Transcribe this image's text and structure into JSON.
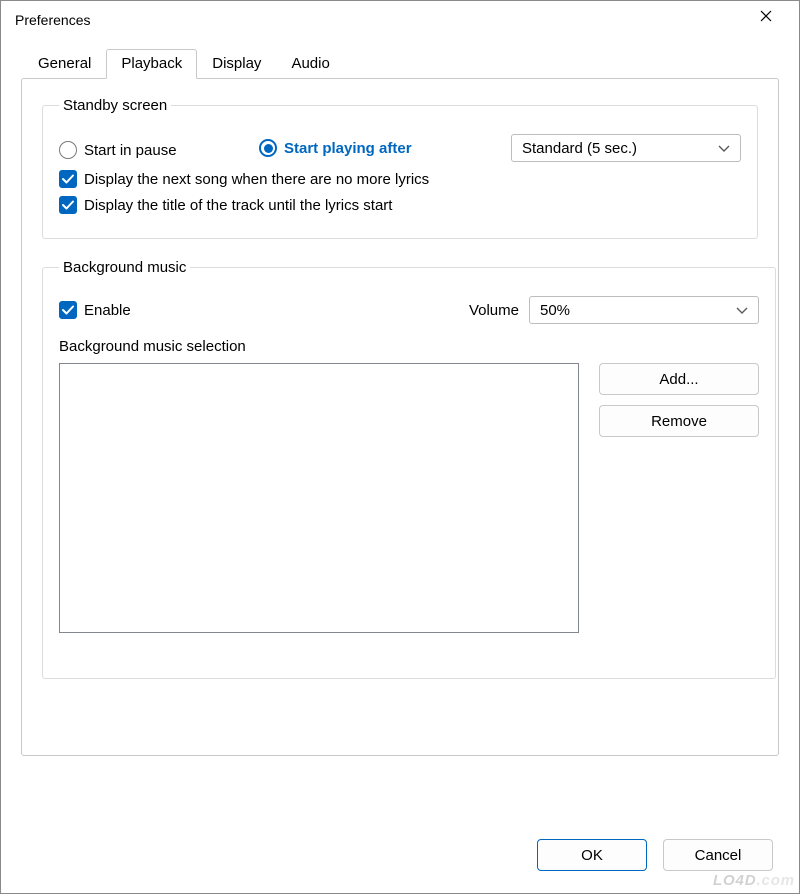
{
  "window": {
    "title": "Preferences"
  },
  "tabs": {
    "general": "General",
    "playback": "Playback",
    "display": "Display",
    "audio": "Audio"
  },
  "standby": {
    "legend": "Standby screen",
    "start_in_pause": "Start in pause",
    "start_playing_after": "Start playing after",
    "delay_value": "Standard (5 sec.)",
    "display_next_song": "Display the next song when there are no more lyrics",
    "display_title_until_lyrics": "Display the title of the track until the lyrics start"
  },
  "bg": {
    "legend": "Background music",
    "enable": "Enable",
    "volume_label": "Volume",
    "volume_value": "50%",
    "selection_label": "Background music selection",
    "add": "Add...",
    "remove": "Remove"
  },
  "buttons": {
    "ok": "OK",
    "cancel": "Cancel"
  },
  "watermark": {
    "brand": "LO4D",
    "suffix": ".com"
  }
}
